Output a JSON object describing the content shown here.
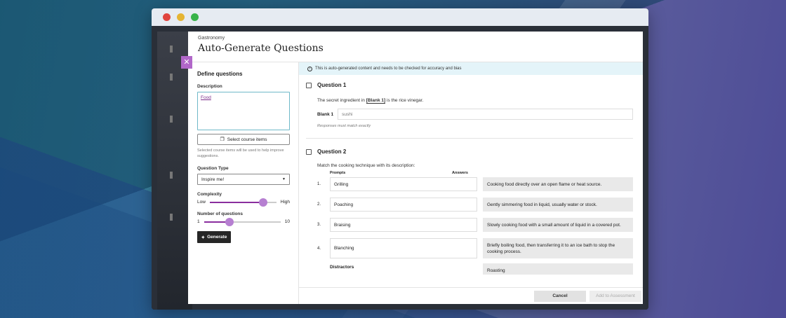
{
  "colors": {
    "accent": "#8a2e9e",
    "banner": "#e4f4f9",
    "primary_button": "#262626"
  },
  "header": {
    "breadcrumb": "Gastronomy",
    "title": "Auto-Generate Questions"
  },
  "left": {
    "section_title": "Define questions",
    "description_label": "Description",
    "description_value": "Food",
    "select_items_label": "Select course items",
    "select_items_hint": "Selected course items will be used to help improve suggestions.",
    "question_type_label": "Question Type",
    "question_type_value": "Inspire me!",
    "complexity_label": "Complexity",
    "complexity_low": "Low",
    "complexity_high": "High",
    "complexity_level": 0.8,
    "num_questions_label": "Number of questions",
    "num_min": "1",
    "num_max": "10",
    "num_level": 0.33,
    "generate_label": "Generate"
  },
  "banner": "This is auto-generated content and needs to be checked for accuracy and bias",
  "q1": {
    "title": "Question 1",
    "text_before": "The secret ingredient in",
    "blank_tag": "[Blank 1]",
    "text_after": "is the rice vinegar.",
    "blank_label": "Blank 1",
    "blank_value": "sushi",
    "note": "Responses must match exactly"
  },
  "q2": {
    "title": "Question 2",
    "text": "Match the cooking technique with its description:",
    "prompts_header": "Prompts",
    "answers_header": "Answers",
    "pairs": [
      {
        "num": "1.",
        "prompt": "Grilling",
        "answer": "Cooking food directly over an open flame or heat source."
      },
      {
        "num": "2.",
        "prompt": "Poaching",
        "answer": "Gently simmering food in liquid, usually water or stock."
      },
      {
        "num": "3.",
        "prompt": "Braising",
        "answer": "Slowly cooking food with a small amount of liquid in a covered pot."
      },
      {
        "num": "4.",
        "prompt": "Blanching",
        "answer": "Briefly boiling food, then transferring it to an ice bath to stop the cooking process."
      }
    ],
    "distractors_label": "Distractors",
    "distractor_1": "Roasting"
  },
  "footer": {
    "cancel": "Cancel",
    "add": "Add to Assessment"
  }
}
